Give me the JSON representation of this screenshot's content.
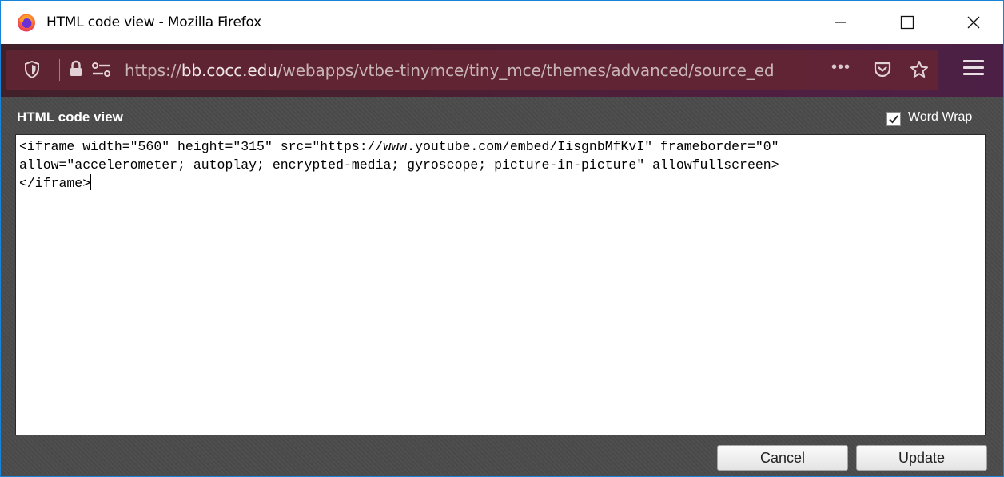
{
  "window": {
    "title": "HTML code view - Mozilla Firefox"
  },
  "address_bar": {
    "url_prefix": "https://",
    "url_host": "bb.cocc.edu",
    "url_path": "/webapps/vtbe-tinymce/tiny_mce/themes/advanced/source_ed",
    "more_label": "•••"
  },
  "dialog": {
    "title": "HTML code view",
    "word_wrap_label": "Word Wrap",
    "word_wrap_checked": true,
    "code_line_1": "<iframe width=\"560\" height=\"315\" src=\"https://www.youtube.com/embed/IisgnbMfKvI\" frameborder=\"0\"",
    "code_line_2": "allow=\"accelerometer; autoplay; encrypted-media; gyroscope; picture-in-picture\" allowfullscreen>",
    "code_line_3": "</iframe>",
    "cancel_label": "Cancel",
    "update_label": "Update"
  },
  "colors": {
    "toolbar": "#4a2030",
    "dialog_bg": "#4b4b4b",
    "window_border": "#1883d7"
  }
}
